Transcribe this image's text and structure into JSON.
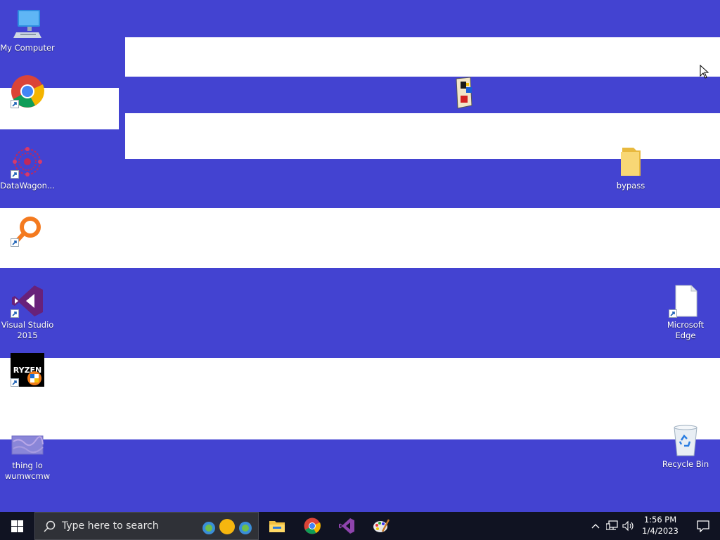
{
  "desktop": {
    "background_color": "#4343d1",
    "band_color": "#ffffff",
    "icons": [
      {
        "name": "my-computer",
        "label": "My Computer",
        "icon": "computer-icon",
        "shortcut": false
      },
      {
        "name": "chrome",
        "label": "",
        "icon": "chrome-icon",
        "shortcut": true
      },
      {
        "name": "datawagon",
        "label": "DataWagon...",
        "icon": "datawagon-icon",
        "shortcut": true
      },
      {
        "name": "orange-search",
        "label": "",
        "icon": "magnifier-icon",
        "shortcut": true
      },
      {
        "name": "visual-studio",
        "label": "Visual Studio 2015",
        "icon": "visual-studio-icon",
        "shortcut": true
      },
      {
        "name": "ryzen-master",
        "label": "",
        "icon": "ryzen-icon",
        "shortcut": true
      },
      {
        "name": "thing-file",
        "label": "thing lo wumwcmw",
        "icon": "image-file-icon",
        "shortcut": false
      },
      {
        "name": "book-app",
        "label": "",
        "icon": "book-icon",
        "shortcut": false
      },
      {
        "name": "bypass-folder",
        "label": "bypass",
        "icon": "folder-icon",
        "shortcut": false
      },
      {
        "name": "microsoft-edge",
        "label": "Microsoft Edge",
        "icon": "blank-file-icon",
        "shortcut": true
      },
      {
        "name": "recycle-bin",
        "label": "Recycle Bin",
        "icon": "recycle-bin-icon",
        "shortcut": false
      }
    ]
  },
  "taskbar": {
    "search_placeholder": "Type here to search",
    "pinned": [
      "file-explorer-icon",
      "chrome-icon",
      "visual-studio-icon",
      "paint-icon"
    ],
    "clock_time": "1:56 PM",
    "clock_date": "1/4/2023",
    "tray_icons": [
      "chevron-up-icon",
      "network-icon",
      "volume-icon"
    ]
  }
}
